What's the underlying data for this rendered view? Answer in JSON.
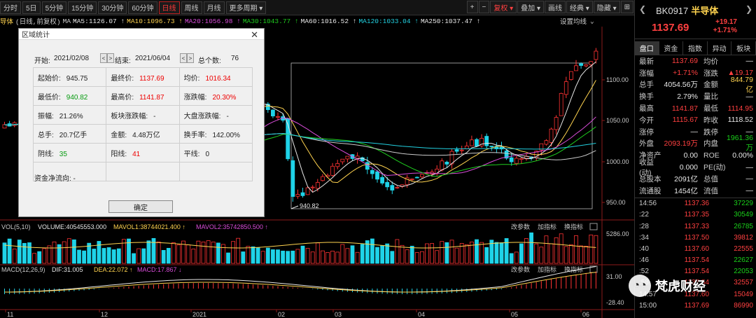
{
  "toolbar": {
    "periods": [
      "分时",
      "5日",
      "5分钟",
      "15分钟",
      "30分钟",
      "60分钟",
      "日线",
      "周线",
      "月线",
      "更多周期"
    ],
    "active_period": "日线",
    "right_buttons": [
      "+",
      "−",
      "复权",
      "叠加",
      "画线",
      "经典",
      "隐藏"
    ],
    "fuquan_label": "复权",
    "header_label": "导体",
    "subtitle": "(日线,前复权)"
  },
  "ma": {
    "label": "MA",
    "items": [
      {
        "text": "MA5:1126.07",
        "color": "#e8e8e8"
      },
      {
        "text": "MA10:1096.73",
        "color": "#ffd34f"
      },
      {
        "text": "MA20:1056.98",
        "color": "#d94cd9"
      },
      {
        "text": "MA30:1043.77",
        "color": "#1fd01f"
      },
      {
        "text": "MA60:1016.52",
        "color": "#e8e8e8"
      },
      {
        "text": "MA120:1033.04",
        "color": "#22d0e0"
      },
      {
        "text": "MA250:1037.47",
        "color": "#e8e8e8"
      }
    ],
    "settings_label": "设置均线"
  },
  "price_axis": [
    "1100.00",
    "1050.00",
    "1000.00",
    "950.00"
  ],
  "vol": {
    "label": "VOL(5,10)",
    "volume": "VOLUME:40545553.000",
    "mavol1": "MAVOL1:38744021.400",
    "mavol2": "MAVOL2:35742850.500",
    "axis_value": "5286.00",
    "btn_params": "改参数",
    "btn_add": "加指标",
    "btn_switch": "换指标"
  },
  "macd": {
    "label": "MACD(12,26,9)",
    "dif": "DIF:31.005",
    "dea": "DEA:22.072",
    "macd": "MACD:17.867",
    "axis_top": "31.00",
    "axis_bottom": "-28.40",
    "btn_params": "改参数",
    "btn_add": "加指标",
    "btn_switch": "换指标"
  },
  "time_axis": [
    "11",
    "12",
    "2021",
    "02",
    "03",
    "04",
    "05",
    "06"
  ],
  "low_annotation": "940.82",
  "dialog": {
    "title": "区域统计",
    "start_label": "开始:",
    "start_date": "2021/02/08",
    "end_label": "结束:",
    "end_date": "2021/06/04",
    "count_label": "总个数:",
    "count": "76",
    "rows": [
      [
        {
          "l": "起始价:",
          "v": "945.75",
          "c": ""
        },
        {
          "l": "最终价:",
          "v": "1137.69",
          "c": "red"
        },
        {
          "l": "均价:",
          "v": "1016.34",
          "c": "red"
        }
      ],
      [
        {
          "l": "最低价:",
          "v": "940.82",
          "c": "green"
        },
        {
          "l": "最高价:",
          "v": "1141.87",
          "c": "red"
        },
        {
          "l": "涨跌幅:",
          "v": "20.30%",
          "c": "red"
        }
      ],
      [
        {
          "l": "振幅:",
          "v": "21.26%",
          "c": ""
        },
        {
          "l": "板块涨跌幅:",
          "v": "-",
          "c": ""
        },
        {
          "l": "大盘涨跌幅:",
          "v": "-",
          "c": ""
        }
      ],
      [
        {
          "l": "总手:",
          "v": "20.7亿手",
          "c": ""
        },
        {
          "l": "金额:",
          "v": "4.48万亿",
          "c": ""
        },
        {
          "l": "换手率:",
          "v": "142.00%",
          "c": ""
        }
      ],
      [
        {
          "l": "阴线:",
          "v": "35",
          "c": "green"
        },
        {
          "l": "阳线:",
          "v": "41",
          "c": "red"
        },
        {
          "l": "平线:",
          "v": "0",
          "c": ""
        }
      ]
    ],
    "flow_label": "资金净流向: -",
    "ok_label": "确定"
  },
  "quote": {
    "code": "BK0917",
    "name": "半导体",
    "price": "1137.69",
    "change": "+19.17",
    "pct": "+1.71%",
    "tabs": [
      "盘口",
      "资金",
      "指数",
      "异动",
      "板块"
    ],
    "rows": [
      {
        "l1": "最新",
        "v1": "1137.69",
        "c1": "c-red",
        "l2": "均价",
        "v2": "—",
        "c2": "c-white"
      },
      {
        "l1": "涨幅",
        "v1": "+1.71%",
        "c1": "c-red",
        "l2": "涨跌",
        "v2": "▲19.17",
        "c2": "c-red"
      },
      {
        "l1": "总手",
        "v1": "4054.56万",
        "c1": "c-white",
        "l2": "金额",
        "v2": "844.79亿",
        "c2": "c-yellow"
      },
      {
        "l1": "换手",
        "v1": "2.79%",
        "c1": "c-white",
        "l2": "量比",
        "v2": "—",
        "c2": "c-white"
      },
      {
        "l1": "最高",
        "v1": "1141.87",
        "c1": "c-red",
        "l2": "最低",
        "v2": "1114.95",
        "c2": "c-red"
      },
      {
        "l1": "今开",
        "v1": "1115.67",
        "c1": "c-red",
        "l2": "昨收",
        "v2": "1118.52",
        "c2": "c-white"
      },
      {
        "l1": "涨停",
        "v1": "—",
        "c1": "c-white",
        "l2": "跌停",
        "v2": "—",
        "c2": "c-white"
      },
      {
        "l1": "外盘",
        "v1": "2093.19万",
        "c1": "c-red",
        "l2": "内盘",
        "v2": "1961.36万",
        "c2": "c-green"
      },
      {
        "l1": "净资产",
        "v1": "0.00",
        "c1": "c-white",
        "l2": "ROE",
        "v2": "0.00%",
        "c2": "c-white"
      },
      {
        "l1": "收益(动)",
        "v1": "0.000",
        "c1": "c-white",
        "l2": "PE(动)",
        "v2": "—",
        "c2": "c-white"
      },
      {
        "l1": "总股本",
        "v1": "2091亿",
        "c1": "c-white",
        "l2": "总值",
        "v2": "—",
        "c2": "c-white"
      },
      {
        "l1": "流通股",
        "v1": "1454亿",
        "c1": "c-white",
        "l2": "流值",
        "v2": "—",
        "c2": "c-white"
      }
    ],
    "ticks": [
      {
        "t": "14:56",
        "p": "1137.36",
        "v": "37229",
        "c": "c-green"
      },
      {
        "t": ":22",
        "p": "1137.35",
        "v": "30549",
        "c": "c-green"
      },
      {
        "t": ":28",
        "p": "1137.33",
        "v": "26785",
        "c": "c-green"
      },
      {
        "t": ":34",
        "p": "1137.50",
        "v": "39812",
        "c": "c-red"
      },
      {
        "t": ":40",
        "p": "1137.60",
        "v": "22555",
        "c": "c-red"
      },
      {
        "t": ":46",
        "p": "1137.54",
        "v": "22627",
        "c": "c-green"
      },
      {
        "t": ":52",
        "p": "1137.54",
        "v": "22053",
        "c": "c-green"
      },
      {
        "t": ":58",
        "p": "1137.54",
        "v": "32557",
        "c": "c-red"
      },
      {
        "t": "14:57",
        "p": "1137.60",
        "v": "15049",
        "c": "c-red"
      },
      {
        "t": "15:00",
        "p": "1137.69",
        "v": "86990",
        "c": "c-red"
      }
    ]
  },
  "watermark": {
    "text": "梵虎财经"
  }
}
